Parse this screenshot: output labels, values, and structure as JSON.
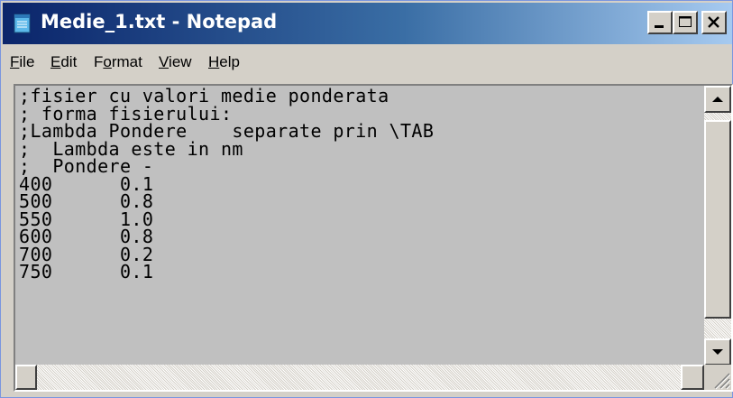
{
  "window": {
    "title": "Medie_1.txt - Notepad",
    "icon": "notepad-icon",
    "title_bar_color": "#0a246a",
    "controls": [
      "minimize-icon",
      "maximize-icon",
      "close-icon"
    ]
  },
  "menu": {
    "items": [
      {
        "label": "File",
        "mnemonic": "F"
      },
      {
        "label": "Edit",
        "mnemonic": "E"
      },
      {
        "label": "Format",
        "mnemonic": "o"
      },
      {
        "label": "View",
        "mnemonic": "V"
      },
      {
        "label": "Help",
        "mnemonic": "H"
      }
    ]
  },
  "editor": {
    "content": ";fisier cu valori medie ponderata\n; forma fisierului:\n;Lambda Pondere    separate prin \\TAB\n;  Lambda este in nm\n;  Pondere -\n400      0.1\n500      0.8\n550      1.0\n600      0.8\n700      0.2\n750      0.1"
  }
}
